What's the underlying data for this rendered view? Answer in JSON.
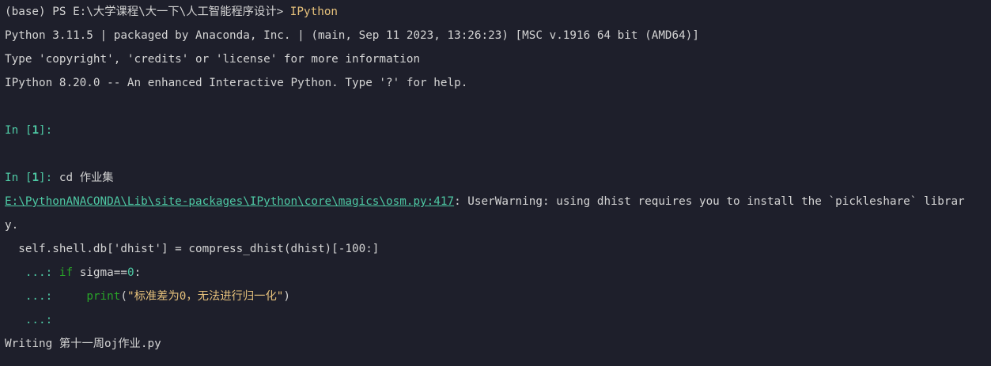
{
  "prompt": {
    "prefix": "(base) PS E:\\大学课程\\大一下\\人工智能程序设计> ",
    "command": "IPython"
  },
  "banner": {
    "python": "Python 3.11.5 | packaged by Anaconda, Inc. | (main, Sep 11 2023, 13:26:23) [MSC v.1916 64 bit (AMD64)]",
    "type_help": "Type 'copyright', 'credits' or 'license' for more information",
    "ipython": "IPython 8.20.0 -- An enhanced Interactive Python. Type '?' for help."
  },
  "in1_empty": {
    "in": "In [",
    "num": "1",
    "close": "]:"
  },
  "in1_cd": {
    "in": "In [",
    "num": "1",
    "close": "]:",
    "cmd": " cd 作业集"
  },
  "warning": {
    "path": "E:\\PythonANACONDA\\Lib\\site-packages\\IPython\\core\\magics\\osm.py:417",
    "msg": ": UserWarning: using dhist requires you to install the `pickleshare` librar",
    "wrap": "y.",
    "code": "  self.shell.db['dhist'] = compress_dhist(dhist)[-100:]"
  },
  "cont1": {
    "prompt": "   ...: ",
    "kw": "if",
    "mid": " sigma==",
    "num": "0",
    "end": ":"
  },
  "cont2": {
    "prompt": "   ...: ",
    "indent": "    ",
    "fn": "print",
    "open": "(",
    "str": "\"标准差为0，无法进行归一化\"",
    "close": ")"
  },
  "cont3": {
    "prompt": "   ...:"
  },
  "output": {
    "writing": "Writing 第十一周oj作业.py"
  }
}
